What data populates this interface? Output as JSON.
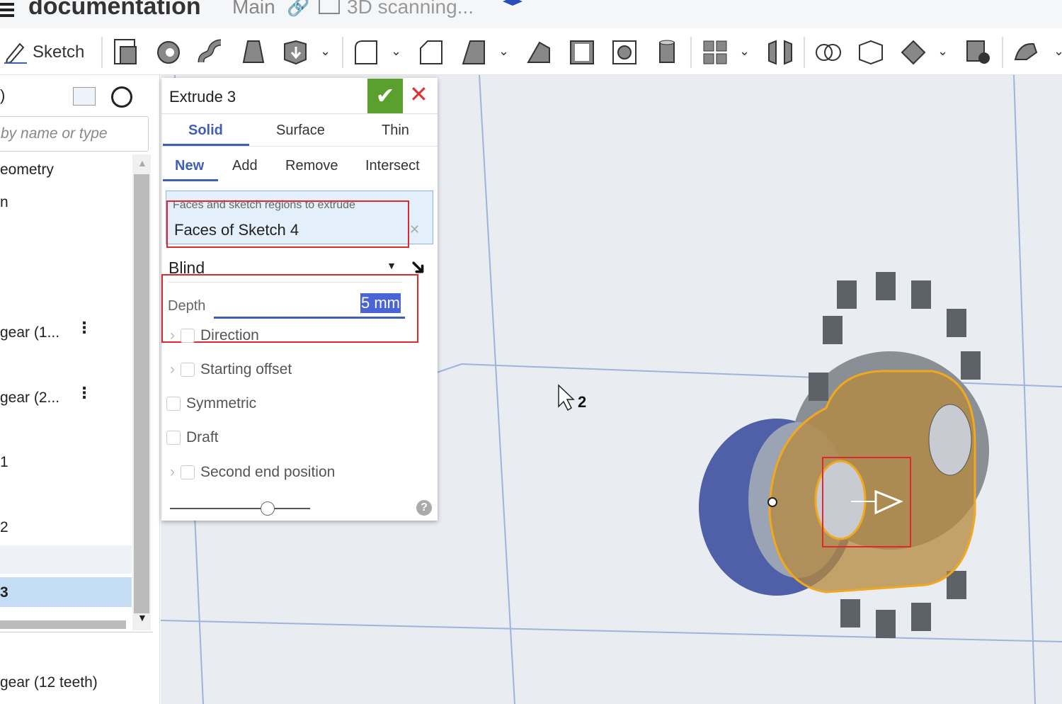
{
  "topbar": {
    "doc_title": "documentation",
    "branch": "Main",
    "tab_label": "3D scanning..."
  },
  "toolbar": {
    "sketch_label": "Sketch"
  },
  "feature_list": {
    "header_suffix": ")",
    "search_placeholder": "by name or type",
    "items": [
      {
        "label": "eometry"
      },
      {
        "label": "n"
      },
      {
        "label": "gear (1..."
      },
      {
        "label": "gear (2..."
      },
      {
        "label": "1"
      },
      {
        "label": "2"
      },
      {
        "label": ""
      },
      {
        "label": "3"
      }
    ],
    "below_item": "gear (12 teeth)"
  },
  "dialog": {
    "title": "Extrude 3",
    "type_tabs": [
      "Solid",
      "Surface",
      "Thin"
    ],
    "active_type": "Solid",
    "op_tabs": [
      "New",
      "Add",
      "Remove",
      "Intersect"
    ],
    "active_op": "New",
    "selection_label": "Faces and sketch regions to extrude",
    "selection_value": "Faces of Sketch 4",
    "end_type": "Blind",
    "depth_label": "Depth",
    "depth_value": "5 mm",
    "options": [
      "Direction",
      "Starting offset",
      "Symmetric",
      "Draft",
      "Second end position"
    ],
    "help": "?"
  },
  "viewport": {
    "cursor_badge": "2"
  },
  "colors": {
    "accent": "#3f5fb5",
    "confirm": "#5aa02c",
    "cancel": "#d33",
    "annotation": "#e0282e",
    "selection": "#e3f0fb",
    "highlight": "#4a63d6"
  }
}
